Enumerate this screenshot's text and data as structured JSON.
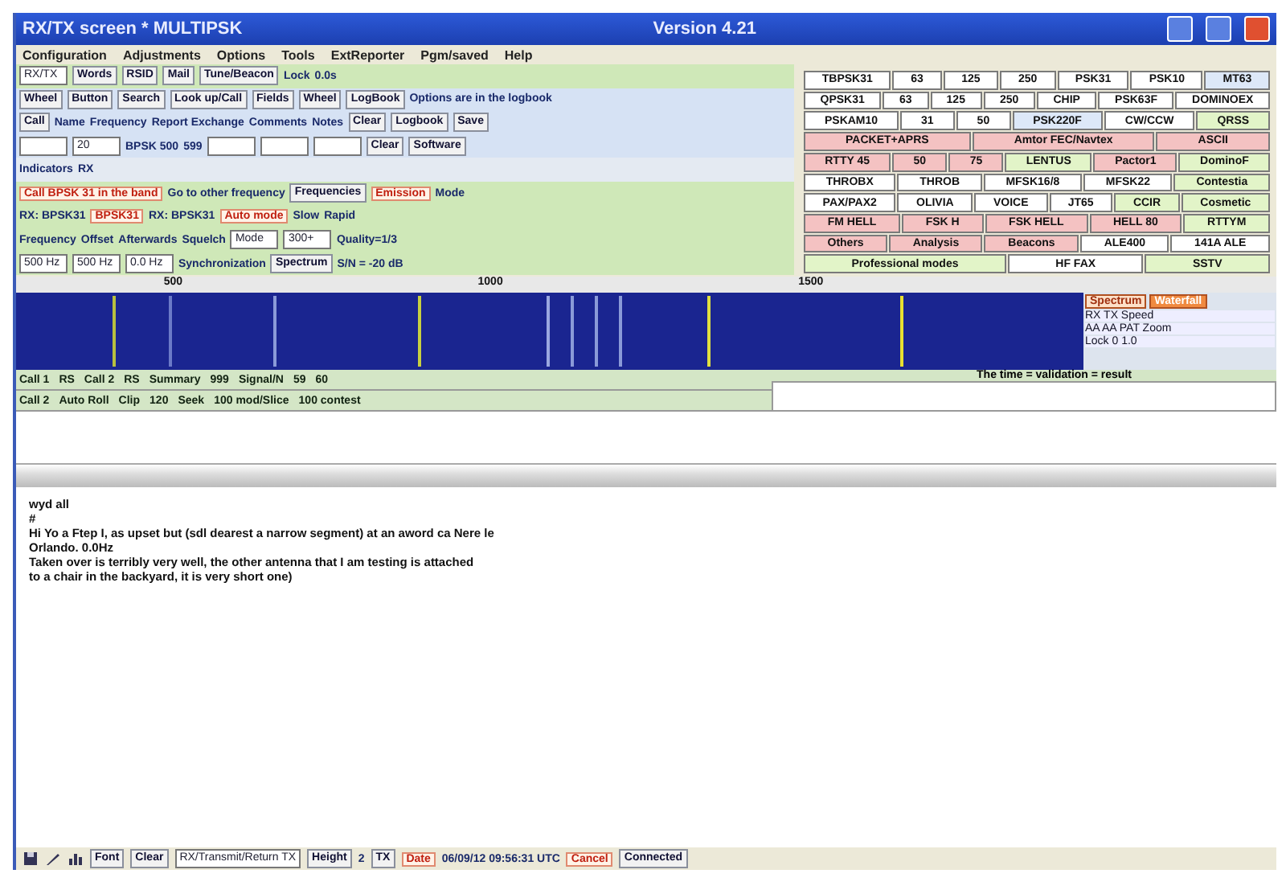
{
  "window": {
    "title": "RX/TX screen  * MULTIPSK",
    "version": "Version 4.21"
  },
  "menu": [
    "Configuration",
    "Adjustments",
    "Options",
    "Tools",
    "ExtReporter",
    "Pgm/saved",
    "Help"
  ],
  "controls": [
    {
      "color": "#cfe8b8",
      "items": [
        {
          "kind": "field",
          "text": "RX/TX"
        },
        {
          "kind": "button",
          "text": "Words"
        },
        {
          "kind": "button",
          "text": "RSID"
        },
        {
          "kind": "button",
          "text": "Mail"
        },
        {
          "kind": "button",
          "text": "Tune/Beacon"
        },
        {
          "kind": "label",
          "text": "Lock"
        },
        {
          "kind": "label",
          "text": "0.0s"
        }
      ]
    },
    {
      "color": "#d6e2f4",
      "items": [
        {
          "kind": "button",
          "text": "Wheel"
        },
        {
          "kind": "button",
          "text": "Button"
        },
        {
          "kind": "button",
          "text": "Search"
        },
        {
          "kind": "button",
          "text": "Look up/Call"
        },
        {
          "kind": "button",
          "text": "Fields"
        },
        {
          "kind": "button",
          "text": "Wheel"
        },
        {
          "kind": "button",
          "text": "LogBook"
        },
        {
          "kind": "label",
          "text": "Options are in the logbook"
        }
      ]
    },
    {
      "color": "#d6e2f4",
      "items": [
        {
          "kind": "button",
          "text": "Call"
        },
        {
          "kind": "label",
          "text": "Name"
        },
        {
          "kind": "label",
          "text": "Frequency"
        },
        {
          "kind": "label",
          "text": "Report Exchange"
        },
        {
          "kind": "label",
          "text": "Comments"
        },
        {
          "kind": "label",
          "text": "Notes"
        },
        {
          "kind": "button",
          "text": "Clear"
        },
        {
          "kind": "button",
          "text": "Logbook"
        },
        {
          "kind": "button",
          "text": "Save"
        }
      ]
    },
    {
      "color": "#d6e2f4",
      "items": [
        {
          "kind": "field"
        },
        {
          "kind": "field",
          "text": "20"
        },
        {
          "kind": "label",
          "text": "BPSK 500"
        },
        {
          "kind": "label",
          "text": "599"
        },
        {
          "kind": "field"
        },
        {
          "kind": "field"
        },
        {
          "kind": "field"
        },
        {
          "kind": "button",
          "text": "Clear"
        },
        {
          "kind": "button",
          "text": "Software"
        }
      ]
    },
    {
      "color": "#e4eaf2",
      "items": [
        {
          "kind": "label",
          "text": "Indicators"
        },
        {
          "kind": "label",
          "text": "RX"
        }
      ]
    },
    {
      "color": "#cfe8b8",
      "items": [
        {
          "kind": "alert",
          "text": "Call BPSK 31 in the band"
        },
        {
          "kind": "label",
          "text": "Go to other frequency"
        },
        {
          "kind": "button",
          "text": "Frequencies"
        },
        {
          "kind": "alert",
          "text": "Emission"
        },
        {
          "kind": "label",
          "text": "Mode"
        }
      ]
    },
    {
      "color": "#cfe8b8",
      "items": [
        {
          "kind": "label",
          "text": "RX: BPSK31"
        },
        {
          "kind": "alert",
          "text": "BPSK31"
        },
        {
          "kind": "label",
          "text": "RX: BPSK31"
        },
        {
          "kind": "alert",
          "text": "Auto mode"
        },
        {
          "kind": "label",
          "text": "Slow"
        },
        {
          "kind": "label",
          "text": "Rapid"
        }
      ]
    },
    {
      "color": "#cfe8b8",
      "items": [
        {
          "kind": "label",
          "text": "Frequency"
        },
        {
          "kind": "label",
          "text": "Offset"
        },
        {
          "kind": "label",
          "text": "Afterwards"
        },
        {
          "kind": "label",
          "text": "Squelch"
        },
        {
          "kind": "field",
          "text": "Mode"
        },
        {
          "kind": "field",
          "text": "300+"
        },
        {
          "kind": "label",
          "text": "Quality=1/3"
        }
      ]
    },
    {
      "color": "#cfe8b8",
      "items": [
        {
          "kind": "field",
          "text": "500 Hz"
        },
        {
          "kind": "field",
          "text": "500 Hz"
        },
        {
          "kind": "field",
          "text": "0.0 Hz"
        },
        {
          "kind": "label",
          "text": "Synchronization"
        },
        {
          "kind": "button",
          "text": "Spectrum"
        },
        {
          "kind": "label",
          "text": "S/N = -20 dB"
        }
      ]
    }
  ],
  "modes": [
    [
      {
        "text": "TBPSK31",
        "color": "#ffffff"
      },
      {
        "text": "63",
        "color": "#ffffff"
      },
      {
        "text": "125",
        "color": "#ffffff"
      },
      {
        "text": "250",
        "color": "#ffffff"
      },
      {
        "text": "PSK31",
        "color": "#ffffff"
      },
      {
        "text": "PSK10",
        "color": "#ffffff"
      },
      {
        "text": "MT63",
        "color": "#dde8f8"
      }
    ],
    [
      {
        "text": "QPSK31",
        "color": "#ffffff"
      },
      {
        "text": "63",
        "color": "#ffffff"
      },
      {
        "text": "125",
        "color": "#ffffff"
      },
      {
        "text": "250",
        "color": "#ffffff"
      },
      {
        "text": "CHIP",
        "color": "#ffffff"
      },
      {
        "text": "PSK63F",
        "color": "#ffffff"
      },
      {
        "text": "DOMINOEX",
        "color": "#ffffff"
      }
    ],
    [
      {
        "text": "PSKAM10",
        "color": "#ffffff"
      },
      {
        "text": "31",
        "color": "#ffffff"
      },
      {
        "text": "50",
        "color": "#ffffff"
      },
      {
        "text": "PSK220F",
        "color": "#dde8f8"
      },
      {
        "text": "CW/CCW",
        "color": "#ffffff"
      },
      {
        "text": "QRSS",
        "color": "#e2f4c8"
      }
    ],
    [
      {
        "text": "PACKET+APRS",
        "color": "#f4c2c2"
      },
      {
        "text": "Amtor FEC/Navtex",
        "color": "#f4c2c2"
      },
      {
        "text": "ASCII",
        "color": "#f4c2c2"
      }
    ],
    [
      {
        "text": "RTTY 45",
        "color": "#f4c2c2"
      },
      {
        "text": "50",
        "color": "#f4c2c2"
      },
      {
        "text": "75",
        "color": "#f4c2c2"
      },
      {
        "text": "LENTUS",
        "color": "#e2f4c8"
      },
      {
        "text": "Pactor1",
        "color": "#f4c2c2"
      },
      {
        "text": "DominoF",
        "color": "#e2f4c8"
      }
    ],
    [
      {
        "text": "THROBX",
        "color": "#ffffff"
      },
      {
        "text": "THROB",
        "color": "#ffffff"
      },
      {
        "text": "MFSK16/8",
        "color": "#ffffff"
      },
      {
        "text": "MFSK22",
        "color": "#ffffff"
      },
      {
        "text": "Contestia",
        "color": "#e2f4c8"
      }
    ],
    [
      {
        "text": "PAX/PAX2",
        "color": "#ffffff"
      },
      {
        "text": "OLIVIA",
        "color": "#ffffff"
      },
      {
        "text": "VOICE",
        "color": "#ffffff"
      },
      {
        "text": "JT65",
        "color": "#ffffff"
      },
      {
        "text": "CCIR",
        "color": "#e2f4c8"
      },
      {
        "text": "Cosmetic",
        "color": "#e2f4c8"
      }
    ],
    [
      {
        "text": "FM HELL",
        "color": "#f4c2c2"
      },
      {
        "text": "FSK H",
        "color": "#f4c2c2"
      },
      {
        "text": "FSK HELL",
        "color": "#f4c2c2"
      },
      {
        "text": "HELL 80",
        "color": "#f4c2c2"
      },
      {
        "text": "RTTYM",
        "color": "#e2f4c8"
      }
    ],
    [
      {
        "text": "Others",
        "color": "#f4c2c2"
      },
      {
        "text": "Analysis",
        "color": "#f4c2c2"
      },
      {
        "text": "Beacons",
        "color": "#f4c2c2"
      },
      {
        "text": "ALE400",
        "color": "#ffffff"
      },
      {
        "text": "141A ALE",
        "color": "#ffffff"
      }
    ],
    [
      {
        "text": "Professional modes",
        "color": "#e2f4c8"
      },
      {
        "text": "HF FAX",
        "color": "#ffffff"
      },
      {
        "text": "SSTV",
        "color": "#e2f4c8"
      }
    ]
  ],
  "scale": [
    "500",
    "1000",
    "1500"
  ],
  "side_panel": {
    "tabs": [
      {
        "label": "Spectrum",
        "selected": false
      },
      {
        "label": "Waterfall",
        "selected": true
      }
    ],
    "rows": [
      "RX  TX  Speed",
      "AA   AA   PAT  Zoom",
      "Lock  0   1.0"
    ]
  },
  "status": [
    [
      {
        "text": "Call 1"
      },
      {
        "text": "RS"
      },
      {
        "text": "Call 2"
      },
      {
        "text": "RS"
      },
      {
        "text": "Summary"
      },
      {
        "text": "999"
      },
      {
        "text": "Signal/N"
      },
      {
        "text": "59"
      },
      {
        "text": "60"
      }
    ],
    [
      {
        "text": "Call 2"
      },
      {
        "text": "Auto Roll"
      },
      {
        "text": "Clip"
      },
      {
        "text": "120"
      },
      {
        "text": "Seek"
      },
      {
        "text": "100 mod/Slice"
      },
      {
        "text": "100 contest"
      }
    ]
  ],
  "status_message": "The time = validation = result",
  "tx_text": [
    "wyd all",
    "#",
    "Hi Yo a Ftep I, as upset but (sdl dearest a narrow segment) at an aword ca Nere le",
    "Orlando.   0.0Hz",
    "Taken over is terribly very well, the other antenna that I am testing is attached",
    "to a chair in the backyard, it is very short one)"
  ],
  "bottom": [
    {
      "kind": "button",
      "text": "Font"
    },
    {
      "kind": "button",
      "text": "Clear"
    },
    {
      "kind": "field",
      "text": "RX/Transmit/Return TX"
    },
    {
      "kind": "button",
      "text": "Height"
    },
    {
      "kind": "label",
      "text": "2"
    },
    {
      "kind": "button",
      "text": "TX"
    },
    {
      "kind": "alert",
      "text": "Date"
    },
    {
      "kind": "label",
      "text": "06/09/12 09:56:31 UTC"
    },
    {
      "kind": "alert",
      "text": "Cancel"
    },
    {
      "kind": "button",
      "text": "Connected"
    }
  ]
}
